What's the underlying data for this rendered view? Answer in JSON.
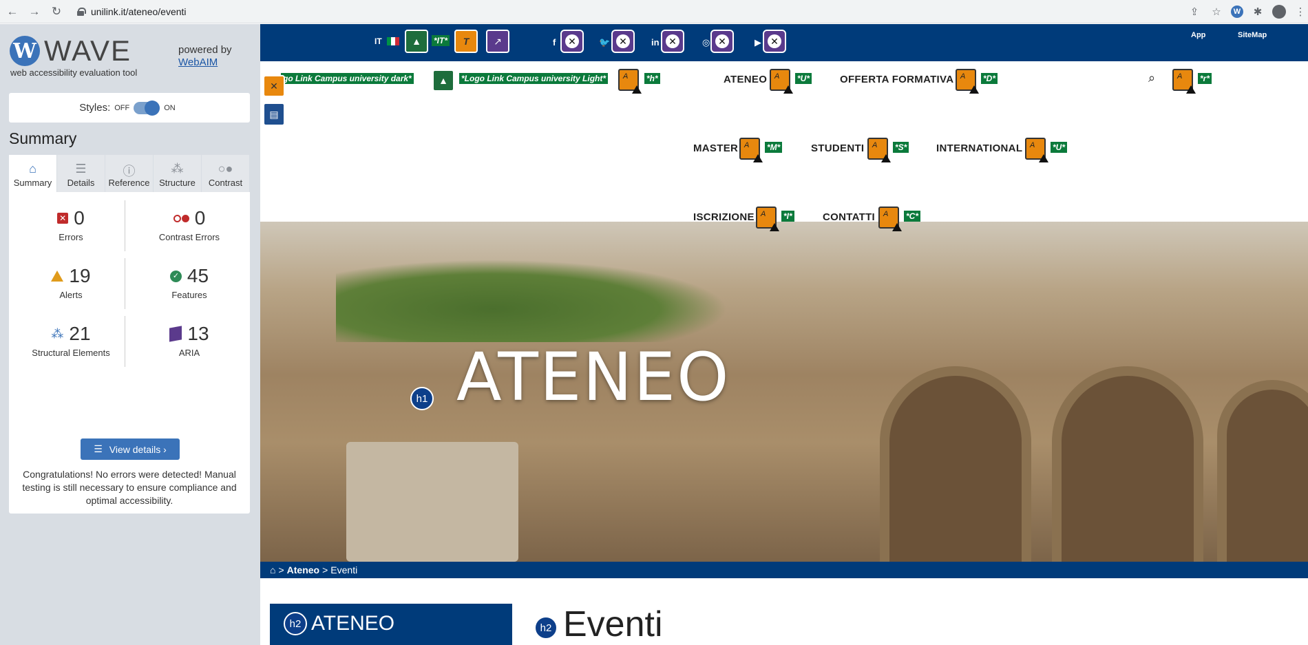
{
  "browser": {
    "url": "unilink.it/ateneo/eventi",
    "back": "←",
    "forward": "→",
    "reload": "↻",
    "ext_wave": "W"
  },
  "wave": {
    "logo_letter": "W",
    "logo_word": "WAVE",
    "tagline": "web accessibility evaluation tool",
    "powered_by": "powered by",
    "webaim": "WebAIM",
    "styles_label": "Styles:",
    "styles_off": "OFF",
    "styles_on": "ON",
    "summary_heading": "Summary",
    "tabs": [
      {
        "label": "Summary",
        "icon": "home-icon"
      },
      {
        "label": "Details",
        "icon": "list-icon"
      },
      {
        "label": "Reference",
        "icon": "info-icon"
      },
      {
        "label": "Structure",
        "icon": "structure-icon"
      },
      {
        "label": "Contrast",
        "icon": "contrast-icon"
      }
    ],
    "stats": {
      "errors": {
        "value": "0",
        "label": "Errors"
      },
      "contrast_errors": {
        "value": "0",
        "label": "Contrast Errors"
      },
      "alerts": {
        "value": "19",
        "label": "Alerts"
      },
      "features": {
        "value": "45",
        "label": "Features"
      },
      "structural": {
        "value": "21",
        "label": "Structural Elements"
      },
      "aria": {
        "value": "13",
        "label": "ARIA"
      }
    },
    "view_details": "View details ›",
    "congrats": "Congratulations! No errors were detected! Manual testing is still necessary to ensure compliance and optimal accessibility."
  },
  "site": {
    "lang": "IT",
    "alt_it": "*IT*",
    "social": [
      "f",
      "🐦",
      "in",
      "◎",
      "▶"
    ],
    "app": "App",
    "sitemap": "SiteMap",
    "logo_dark_alt": "go Link Campus university dark*",
    "logo_light_alt": "*Logo Link Campus university Light*",
    "logo_h": "*h*",
    "menu": [
      {
        "label": "ATENEO",
        "tag": "*U*"
      },
      {
        "label": "OFFERTA FORMATIVA",
        "tag": "*D*"
      },
      {
        "label": "MASTER",
        "tag": "*M*"
      },
      {
        "label": "STUDENTI",
        "tag": "*S*"
      },
      {
        "label": "INTERNATIONAL",
        "tag": "*U*"
      },
      {
        "label": "ISCRIZIONE",
        "tag": "*I*"
      },
      {
        "label": "CONTATTI",
        "tag": "*C*"
      }
    ],
    "search_tag": "*r*",
    "hero_title": "ATENEO",
    "h1": "h1",
    "h2": "h2",
    "breadcrumb": {
      "sep1": ">",
      "ateneo": "Ateneo",
      "sep2": ">",
      "current": "Eventi"
    },
    "side_title": "ATENEO",
    "page_title": "Eventi"
  },
  "colors": {
    "navy": "#003b7a",
    "wave_blue": "#3b73b9",
    "wave_orange": "#e8880e",
    "wave_green": "#0b7a3b",
    "wave_purple": "#5a3a8c"
  }
}
